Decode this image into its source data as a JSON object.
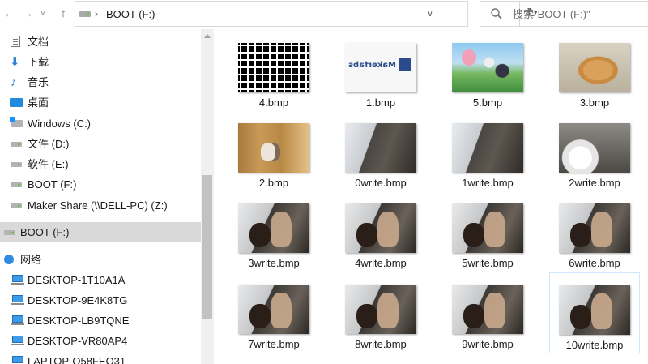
{
  "toolbar": {
    "address_text": "BOOT (F:)",
    "search_placeholder": "搜索\"BOOT (F:)\""
  },
  "sidebar": {
    "items": [
      {
        "label": "文档",
        "icon": "document-icon"
      },
      {
        "label": "下载",
        "icon": "download-icon"
      },
      {
        "label": "音乐",
        "icon": "music-icon"
      },
      {
        "label": "桌面",
        "icon": "desktop-icon"
      },
      {
        "label": "Windows (C:)",
        "icon": "windows-drive-icon"
      },
      {
        "label": "文件 (D:)",
        "icon": "drive-icon"
      },
      {
        "label": "软件 (E:)",
        "icon": "drive-icon"
      },
      {
        "label": "BOOT (F:)",
        "icon": "drive-icon"
      },
      {
        "label": "Maker Share (\\\\DELL-PC) (Z:)",
        "icon": "network-drive-icon"
      },
      {
        "label": "BOOT (F:)",
        "icon": "drive-icon",
        "selected": true
      },
      {
        "label": "网络",
        "icon": "network-icon"
      },
      {
        "label": "DESKTOP-1T10A1A",
        "icon": "computer-icon"
      },
      {
        "label": "DESKTOP-9E4K8TG",
        "icon": "computer-icon"
      },
      {
        "label": "DESKTOP-LB9TQNE",
        "icon": "computer-icon"
      },
      {
        "label": "DESKTOP-VR80AP4",
        "icon": "computer-icon"
      },
      {
        "label": "LAPTOP-Q58FEO31",
        "icon": "computer-icon"
      }
    ]
  },
  "files": [
    {
      "name": "4.bmp"
    },
    {
      "name": "1.bmp",
      "thumb_text": "Makerfabs"
    },
    {
      "name": "5.bmp"
    },
    {
      "name": "3.bmp"
    },
    {
      "name": "2.bmp"
    },
    {
      "name": "0write.bmp"
    },
    {
      "name": "1write.bmp"
    },
    {
      "name": "2write.bmp"
    },
    {
      "name": "3write.bmp"
    },
    {
      "name": "4write.bmp"
    },
    {
      "name": "5write.bmp"
    },
    {
      "name": "6write.bmp"
    },
    {
      "name": "7write.bmp"
    },
    {
      "name": "8write.bmp"
    },
    {
      "name": "9write.bmp"
    },
    {
      "name": "10write.bmp",
      "selected": true
    }
  ],
  "colors": {
    "selected_row_bg": "#d9d9d9",
    "selected_tile_border": "#cde8ff",
    "accent_blue": "#2b7fd4"
  }
}
